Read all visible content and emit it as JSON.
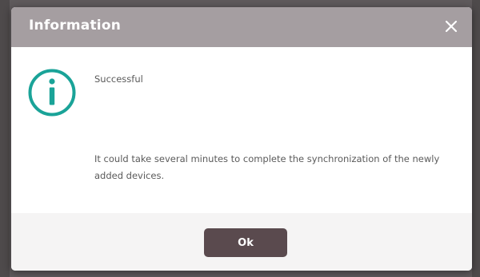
{
  "dialog": {
    "title": "Information",
    "close_icon": "close-icon",
    "status_icon": "info-circle-icon",
    "message_title": "Successful",
    "message_detail": "It could take several minutes to complete the synchronization of the newly added devices.",
    "ok_label": "Ok"
  },
  "colors": {
    "header": "#a59ea1",
    "accent_icon": "#1aa398",
    "button": "#5a4a4e",
    "footer": "#f5f4f4",
    "text": "#5a5a5a"
  }
}
